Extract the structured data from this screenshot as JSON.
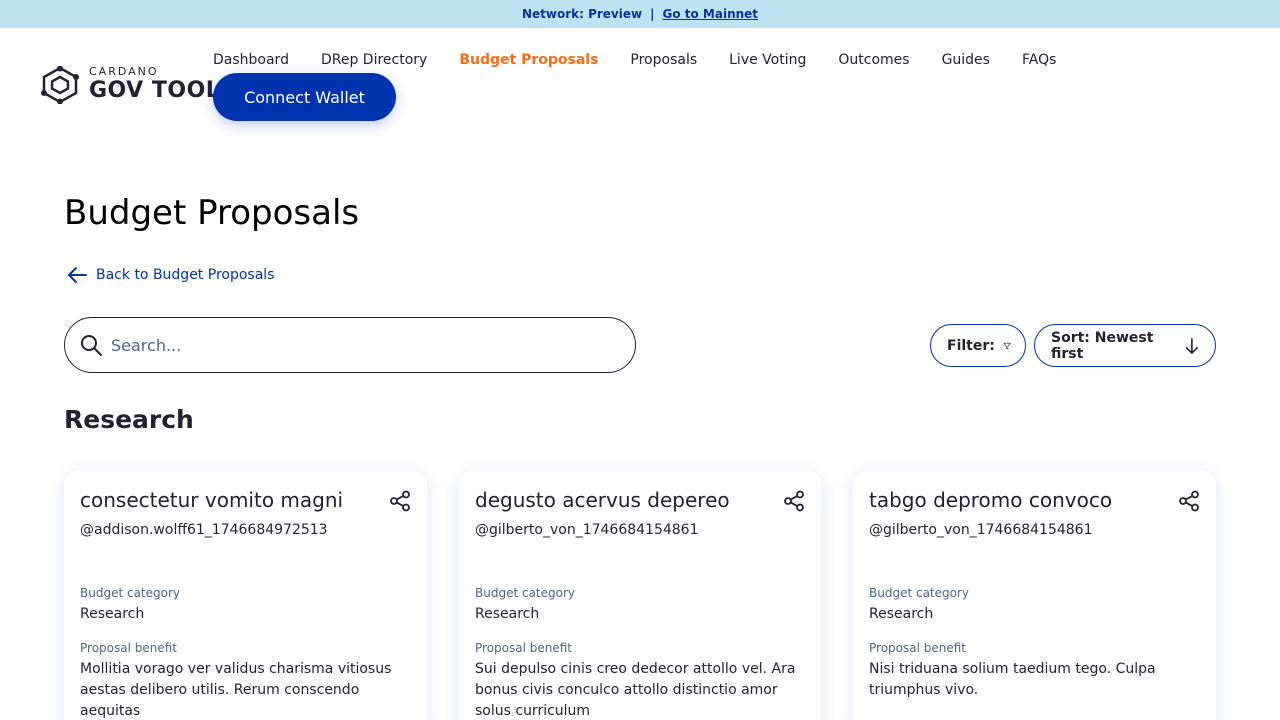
{
  "banner": {
    "network": "Network: Preview",
    "separator": "|",
    "link": "Go to Mainnet"
  },
  "logo": {
    "top": "CARDANO",
    "bottom": "GOV TOOL"
  },
  "nav": {
    "items": [
      {
        "label": "Dashboard",
        "active": false
      },
      {
        "label": "DRep Directory",
        "active": false
      },
      {
        "label": "Budget Proposals",
        "active": true
      },
      {
        "label": "Proposals",
        "active": false
      },
      {
        "label": "Live Voting",
        "active": false
      },
      {
        "label": "Outcomes",
        "active": false
      },
      {
        "label": "Guides",
        "active": false
      },
      {
        "label": "FAQs",
        "active": false
      }
    ],
    "connect_label": "Connect Wallet"
  },
  "page": {
    "title": "Budget Proposals",
    "back_label": "Back to Budget Proposals"
  },
  "search": {
    "placeholder": "Search..."
  },
  "toolbar": {
    "filter_label": "Filter:",
    "sort_label": "Sort: Newest first"
  },
  "section": {
    "title": "Research"
  },
  "cards": [
    {
      "title": "consectetur vomito magni",
      "author": "@addison.wolff61_1746684972513",
      "category_label": "Budget category",
      "category": "Research",
      "benefit_label": "Proposal benefit",
      "benefit": "Mollitia vorago ver validus charisma vitiosus aestas delibero utilis. Rerum conscendo aequitas"
    },
    {
      "title": "degusto acervus depereo",
      "author": "@gilberto_von_1746684154861",
      "category_label": "Budget category",
      "category": "Research",
      "benefit_label": "Proposal benefit",
      "benefit": "Sui depulso cinis creo dedecor attollo vel. Ara bonus civis conculco attollo distinctio amor solus curriculum"
    },
    {
      "title": "tabgo depromo convoco",
      "author": "@gilberto_von_1746684154861",
      "category_label": "Budget category",
      "category": "Research",
      "benefit_label": "Proposal benefit",
      "benefit": "Nisi triduana solium taedium tego. Culpa triumphus vivo."
    }
  ],
  "colors": {
    "accent": "#0033ad",
    "active_nav": "#f26f19",
    "banner_bg": "#bde3f2"
  }
}
